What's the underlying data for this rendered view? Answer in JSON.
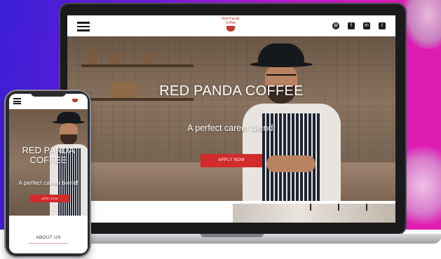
{
  "site": {
    "hero_title": "RED PANDA COFFEE",
    "hero_subtitle": "A perfect career blend!",
    "apply_button": "APPLY NOW",
    "about_heading": "ABOUT US",
    "logo_text": "Red Panda Coffee"
  },
  "mobile": {
    "hero_title_line1": "RED PANDA",
    "hero_title_line2": "COFFEE",
    "hero_subtitle": "A perfect career blend!",
    "apply_button": "APPLY NOW",
    "about_heading": "ABOUT US"
  },
  "social_icons": [
    "globe-icon",
    "facebook-icon",
    "linkedin-icon",
    "twitter-icon"
  ],
  "colors": {
    "brand_red": "#d12b2b",
    "bg_gradient_start": "#3a1fd6",
    "bg_gradient_end": "#e21eb1"
  }
}
